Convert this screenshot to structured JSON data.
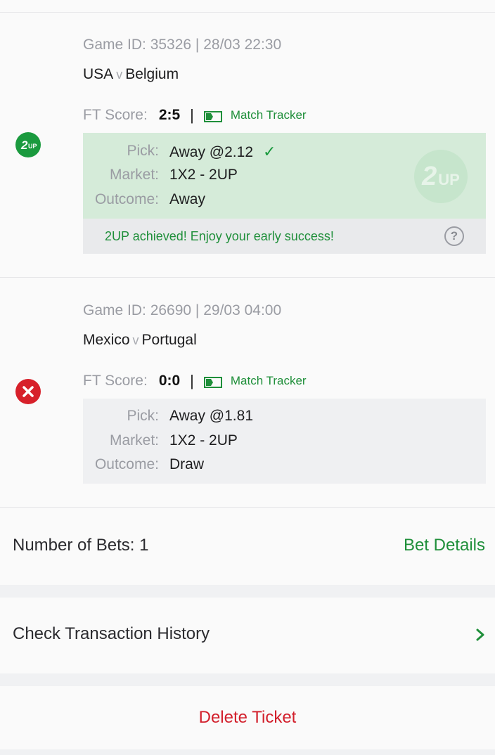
{
  "games": [
    {
      "game_id_line": "Game ID: 35326 | 28/03 22:30",
      "home": "USA",
      "vs": "v",
      "away": "Belgium",
      "ft_label": "FT Score:",
      "ft_score": "2:5",
      "separator": "|",
      "tracker_label": "Match Tracker",
      "status_icon": "2up-badge-icon",
      "pick_label": "Pick:",
      "pick_value": "Away @2.12",
      "market_label": "Market:",
      "market_value": "1X2 - 2UP",
      "outcome_label": "Outcome:",
      "outcome_value": "Away",
      "watermark": "2UP",
      "notice": "2UP achieved! Enjoy your early success!"
    },
    {
      "game_id_line": "Game ID: 26690 | 29/03 04:00",
      "home": "Mexico",
      "vs": "v",
      "away": "Portugal",
      "ft_label": "FT Score:",
      "ft_score": "0:0",
      "separator": "|",
      "tracker_label": "Match Tracker",
      "status_icon": "lost-x-icon",
      "pick_label": "Pick:",
      "pick_value": "Away @1.81",
      "market_label": "Market:",
      "market_value": "1X2 - 2UP",
      "outcome_label": "Outcome:",
      "outcome_value": "Draw"
    }
  ],
  "summary": {
    "bets_label": "Number of Bets: 1",
    "bet_details": "Bet Details"
  },
  "history": {
    "label": "Check Transaction History"
  },
  "actions": {
    "delete": "Delete Ticket"
  },
  "colors": {
    "accent_green": "#1f8f3a",
    "win_bg": "#d5ebd9",
    "danger_red": "#d21f2b"
  }
}
